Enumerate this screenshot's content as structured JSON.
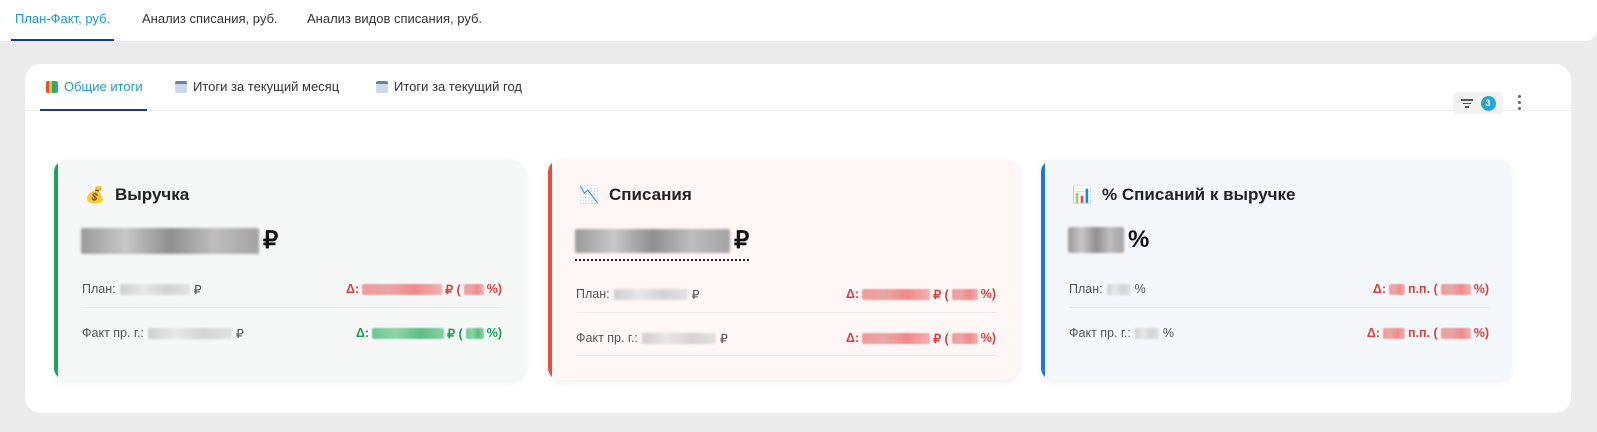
{
  "top_tabs": [
    {
      "label": "План-Факт, руб."
    },
    {
      "label": "Анализ списания, руб."
    },
    {
      "label": "Анализ видов списания, руб."
    }
  ],
  "sub_tabs": [
    {
      "label": "Общие итоги",
      "icon": "bar-chart-icon"
    },
    {
      "label": "Итоги за текущий месяц",
      "icon": "calendar-icon"
    },
    {
      "label": "Итоги за текущий год",
      "icon": "calendar-icon"
    }
  ],
  "filter": {
    "count": "3"
  },
  "cards": [
    {
      "title": "Выручка",
      "emoji": "💰",
      "accent": "#1aa563",
      "bg": "#f5f8f7",
      "value_unit": "₽",
      "plan_label": "План:",
      "plan_unit": "₽",
      "plan_delta_prefix": "Δ:",
      "plan_delta_unit": "₽ (",
      "plan_delta_suffix": "%)",
      "prev_label": "Факт пр. г.:",
      "prev_unit": "₽",
      "prev_delta_prefix": "Δ:",
      "prev_delta_unit": "₽ (",
      "prev_delta_suffix": "%)"
    },
    {
      "title": "Списания",
      "emoji": "📉",
      "accent": "#e74c3c",
      "bg": "#fff7f6",
      "value_unit": "₽",
      "plan_label": "План:",
      "plan_unit": "₽",
      "plan_delta_prefix": "Δ:",
      "plan_delta_unit": "₽ (",
      "plan_delta_suffix": "%)",
      "prev_label": "Факт пр. г.:",
      "prev_unit": "₽",
      "prev_delta_prefix": "Δ:",
      "prev_delta_unit": "₽ (",
      "prev_delta_suffix": "%)"
    },
    {
      "title": "% Списаний к выручке",
      "emoji": "📊",
      "accent": "#1f7ad6",
      "bg": "#f5f8fb",
      "value_unit": "%",
      "plan_label": "План:",
      "plan_unit": "%",
      "plan_delta_prefix": "Δ:",
      "plan_delta_unit": "п.п. (",
      "plan_delta_suffix": "%)",
      "prev_label": "Факт пр. г.:",
      "prev_unit": "%",
      "prev_delta_prefix": "Δ:",
      "prev_delta_unit": "п.п. (",
      "prev_delta_suffix": "%)"
    }
  ]
}
